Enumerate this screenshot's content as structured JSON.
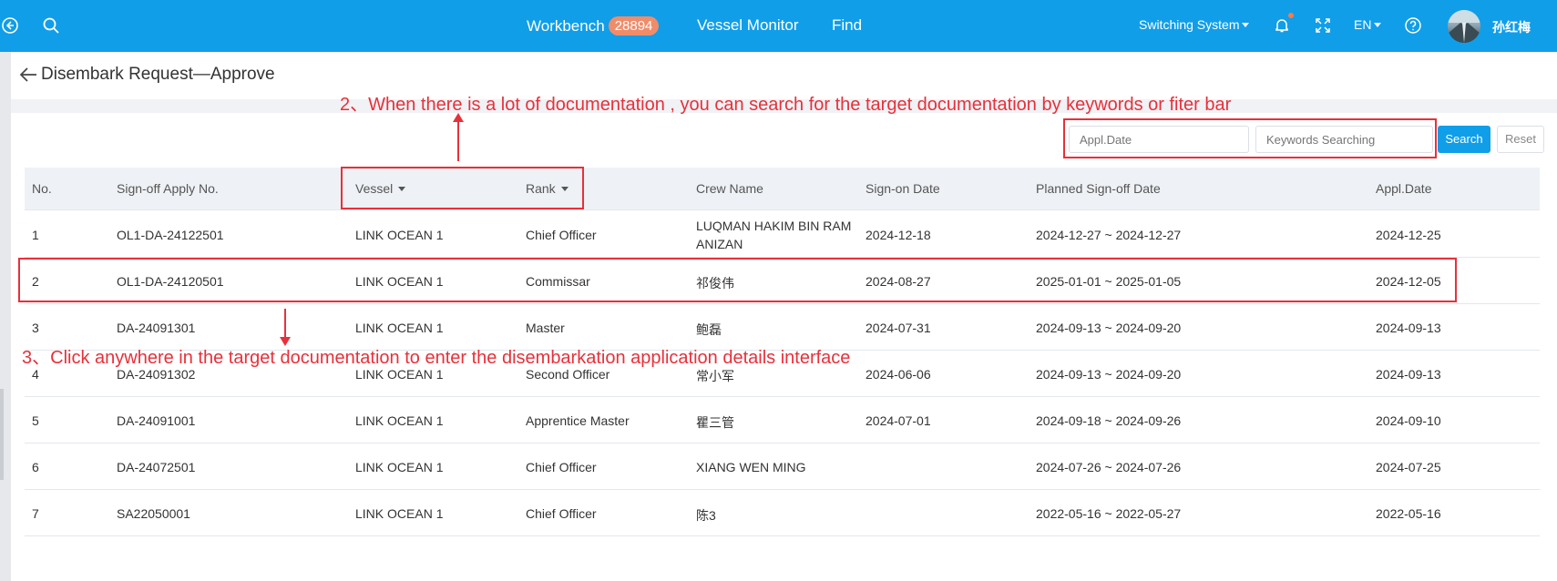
{
  "topbar": {
    "nav": {
      "workbench": "Workbench",
      "workbench_badge": "28894",
      "vessel_monitor": "Vessel Monitor",
      "find": "Find"
    },
    "switching_system": "Switching System",
    "language": "EN",
    "user_name": "孙红梅"
  },
  "page": {
    "title": "Disembark Request—Approve"
  },
  "filters": {
    "appl_date_placeholder": "Appl.Date",
    "keywords_placeholder": "Keywords Searching",
    "search_label": "Search",
    "reset_label": "Reset"
  },
  "table": {
    "headers": {
      "no": "No.",
      "apply_no": "Sign-off Apply No.",
      "vessel": "Vessel",
      "rank": "Rank",
      "crew_name": "Crew Name",
      "sign_on_date": "Sign-on Date",
      "planned_sign_off": "Planned Sign-off Date",
      "appl_date": "Appl.Date"
    },
    "rows": [
      {
        "no": "1",
        "apply_no": "OL1-DA-24122501",
        "vessel": "LINK OCEAN 1",
        "rank": "Chief Officer",
        "crew_name": "LUQMAN HAKIM BIN RAM ANIZAN",
        "sign_on_date": "2024-12-18",
        "planned_sign_off": "2024-12-27 ~ 2024-12-27",
        "appl_date": "2024-12-25"
      },
      {
        "no": "2",
        "apply_no": "OL1-DA-24120501",
        "vessel": "LINK OCEAN 1",
        "rank": "Commissar",
        "crew_name": "祁俊伟",
        "sign_on_date": "2024-08-27",
        "planned_sign_off": "2025-01-01 ~ 2025-01-05",
        "appl_date": "2024-12-05"
      },
      {
        "no": "3",
        "apply_no": "DA-24091301",
        "vessel": "LINK OCEAN 1",
        "rank": "Master",
        "crew_name": "鲍磊",
        "sign_on_date": "2024-07-31",
        "planned_sign_off": "2024-09-13 ~ 2024-09-20",
        "appl_date": "2024-09-13"
      },
      {
        "no": "4",
        "apply_no": "DA-24091302",
        "vessel": "LINK OCEAN 1",
        "rank": "Second Officer",
        "crew_name": "常小军",
        "sign_on_date": "2024-06-06",
        "planned_sign_off": "2024-09-13 ~ 2024-09-20",
        "appl_date": "2024-09-13"
      },
      {
        "no": "5",
        "apply_no": "DA-24091001",
        "vessel": "LINK OCEAN 1",
        "rank": "Apprentice Master",
        "crew_name": "瞿三管",
        "sign_on_date": "2024-07-01",
        "planned_sign_off": "2024-09-18 ~ 2024-09-26",
        "appl_date": "2024-09-10"
      },
      {
        "no": "6",
        "apply_no": "DA-24072501",
        "vessel": "LINK OCEAN 1",
        "rank": "Chief Officer",
        "crew_name": "XIANG WEN MING",
        "sign_on_date": "",
        "planned_sign_off": "2024-07-26 ~ 2024-07-26",
        "appl_date": "2024-07-25"
      },
      {
        "no": "7",
        "apply_no": "SA22050001",
        "vessel": "LINK OCEAN 1",
        "rank": "Chief Officer",
        "crew_name": "陈3",
        "sign_on_date": "",
        "planned_sign_off": "2022-05-16 ~ 2022-05-27",
        "appl_date": "2022-05-16"
      }
    ]
  },
  "annotations": {
    "note2": "2、When there is a lot of documentation , you can search for the target documentation by keywords or fiter bar",
    "note3": "3、Click anywhere in the target documentation to enter the disembarkation application details interface"
  },
  "colors": {
    "topbar": "#109ee9",
    "badge": "#f08c6a",
    "annotation": "#e8303a"
  }
}
